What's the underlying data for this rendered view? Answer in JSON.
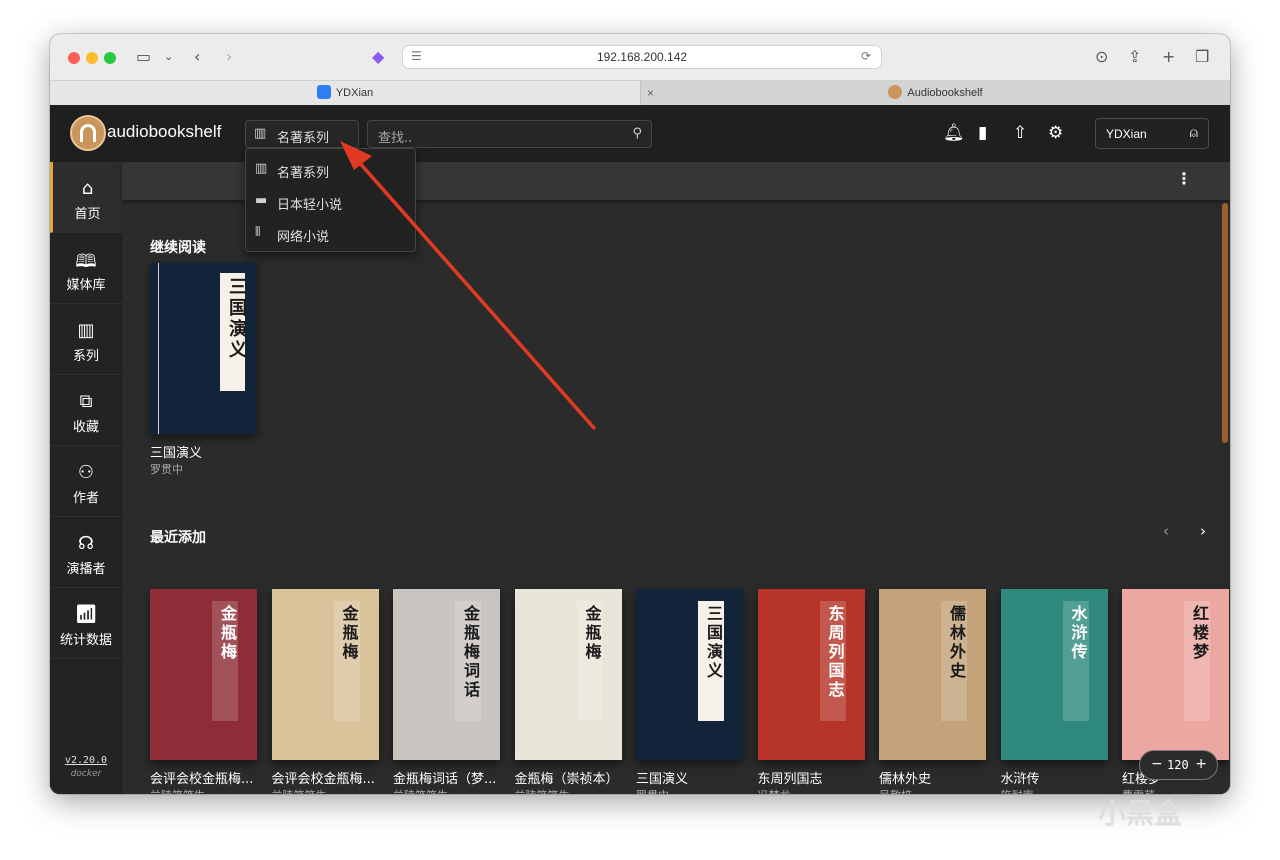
{
  "browser": {
    "address": "192.168.200.142",
    "tabs": [
      {
        "label": "YDXian",
        "favicon_color": "#2f7df6"
      },
      {
        "label": "Audiobookshelf",
        "favicon_color": "#c9955d"
      }
    ],
    "traffic_lights": {
      "red": "#fe5f57",
      "yellow": "#febc2e",
      "green": "#28c840"
    }
  },
  "app": {
    "title": "audiobookshelf",
    "library_selected": "名著系列",
    "search_placeholder": "查找..",
    "user": "YDXian",
    "accent": "#e8a33d"
  },
  "library_dropdown": {
    "options": [
      {
        "label": "名著系列",
        "icon": "library-icon"
      },
      {
        "label": "日本轻小说",
        "icon": "book-icon"
      },
      {
        "label": "网络小说",
        "icon": "books-icon"
      }
    ]
  },
  "sidebar": {
    "items": [
      {
        "label": "首页",
        "icon": "home-icon"
      },
      {
        "label": "媒体库",
        "icon": "open-book-icon"
      },
      {
        "label": "系列",
        "icon": "series-icon"
      },
      {
        "label": "收藏",
        "icon": "collection-icon"
      },
      {
        "label": "作者",
        "icon": "authors-icon"
      },
      {
        "label": "演播者",
        "icon": "narrator-icon"
      },
      {
        "label": "统计数据",
        "icon": "stats-icon"
      }
    ],
    "version": "v2.20.0",
    "build": "docker"
  },
  "continue_reading": {
    "title": "继续阅读",
    "books": [
      {
        "title": "三国演义",
        "author": "罗贯中",
        "cover_text": "三国演义",
        "color": "#13243a"
      }
    ]
  },
  "recently_added": {
    "title": "最近添加",
    "books": [
      {
        "title": "会评会校金瓶梅...",
        "author": "兰陵笑笑生",
        "cover_text": "金瓶梅",
        "color": "#8e2d37"
      },
      {
        "title": "会评会校金瓶梅...",
        "author": "兰陵笑笑生",
        "cover_text": "金瓶梅",
        "color": "#d8c39b"
      },
      {
        "title": "金瓶梅词话（梦...",
        "author": "兰陵笑笑生",
        "cover_text": "金瓶梅词话",
        "color": "#c9c4c0"
      },
      {
        "title": "金瓶梅（崇祯本）",
        "author": "兰陵笑笑生",
        "cover_text": "金瓶梅",
        "color": "#e9e4d8"
      },
      {
        "title": "三国演义",
        "author": "罗贯中",
        "cover_text": "三国演义",
        "color": "#13243a"
      },
      {
        "title": "东周列国志",
        "author": "冯梦龙",
        "cover_text": "东周列国志",
        "color": "#b63528"
      },
      {
        "title": "儒林外史",
        "author": "吴敬梓",
        "cover_text": "儒林外史",
        "color": "#c4a37a"
      },
      {
        "title": "水浒传",
        "author": "施耐庵",
        "cover_text": "水浒传",
        "color": "#2f8a7d"
      },
      {
        "title": "红楼梦",
        "author": "曹雪芹",
        "cover_text": "红楼梦",
        "color": "#eda7a2"
      }
    ]
  },
  "zoom": {
    "minus": "−",
    "value": "120",
    "plus": "+"
  },
  "watermark": "小黑盒"
}
